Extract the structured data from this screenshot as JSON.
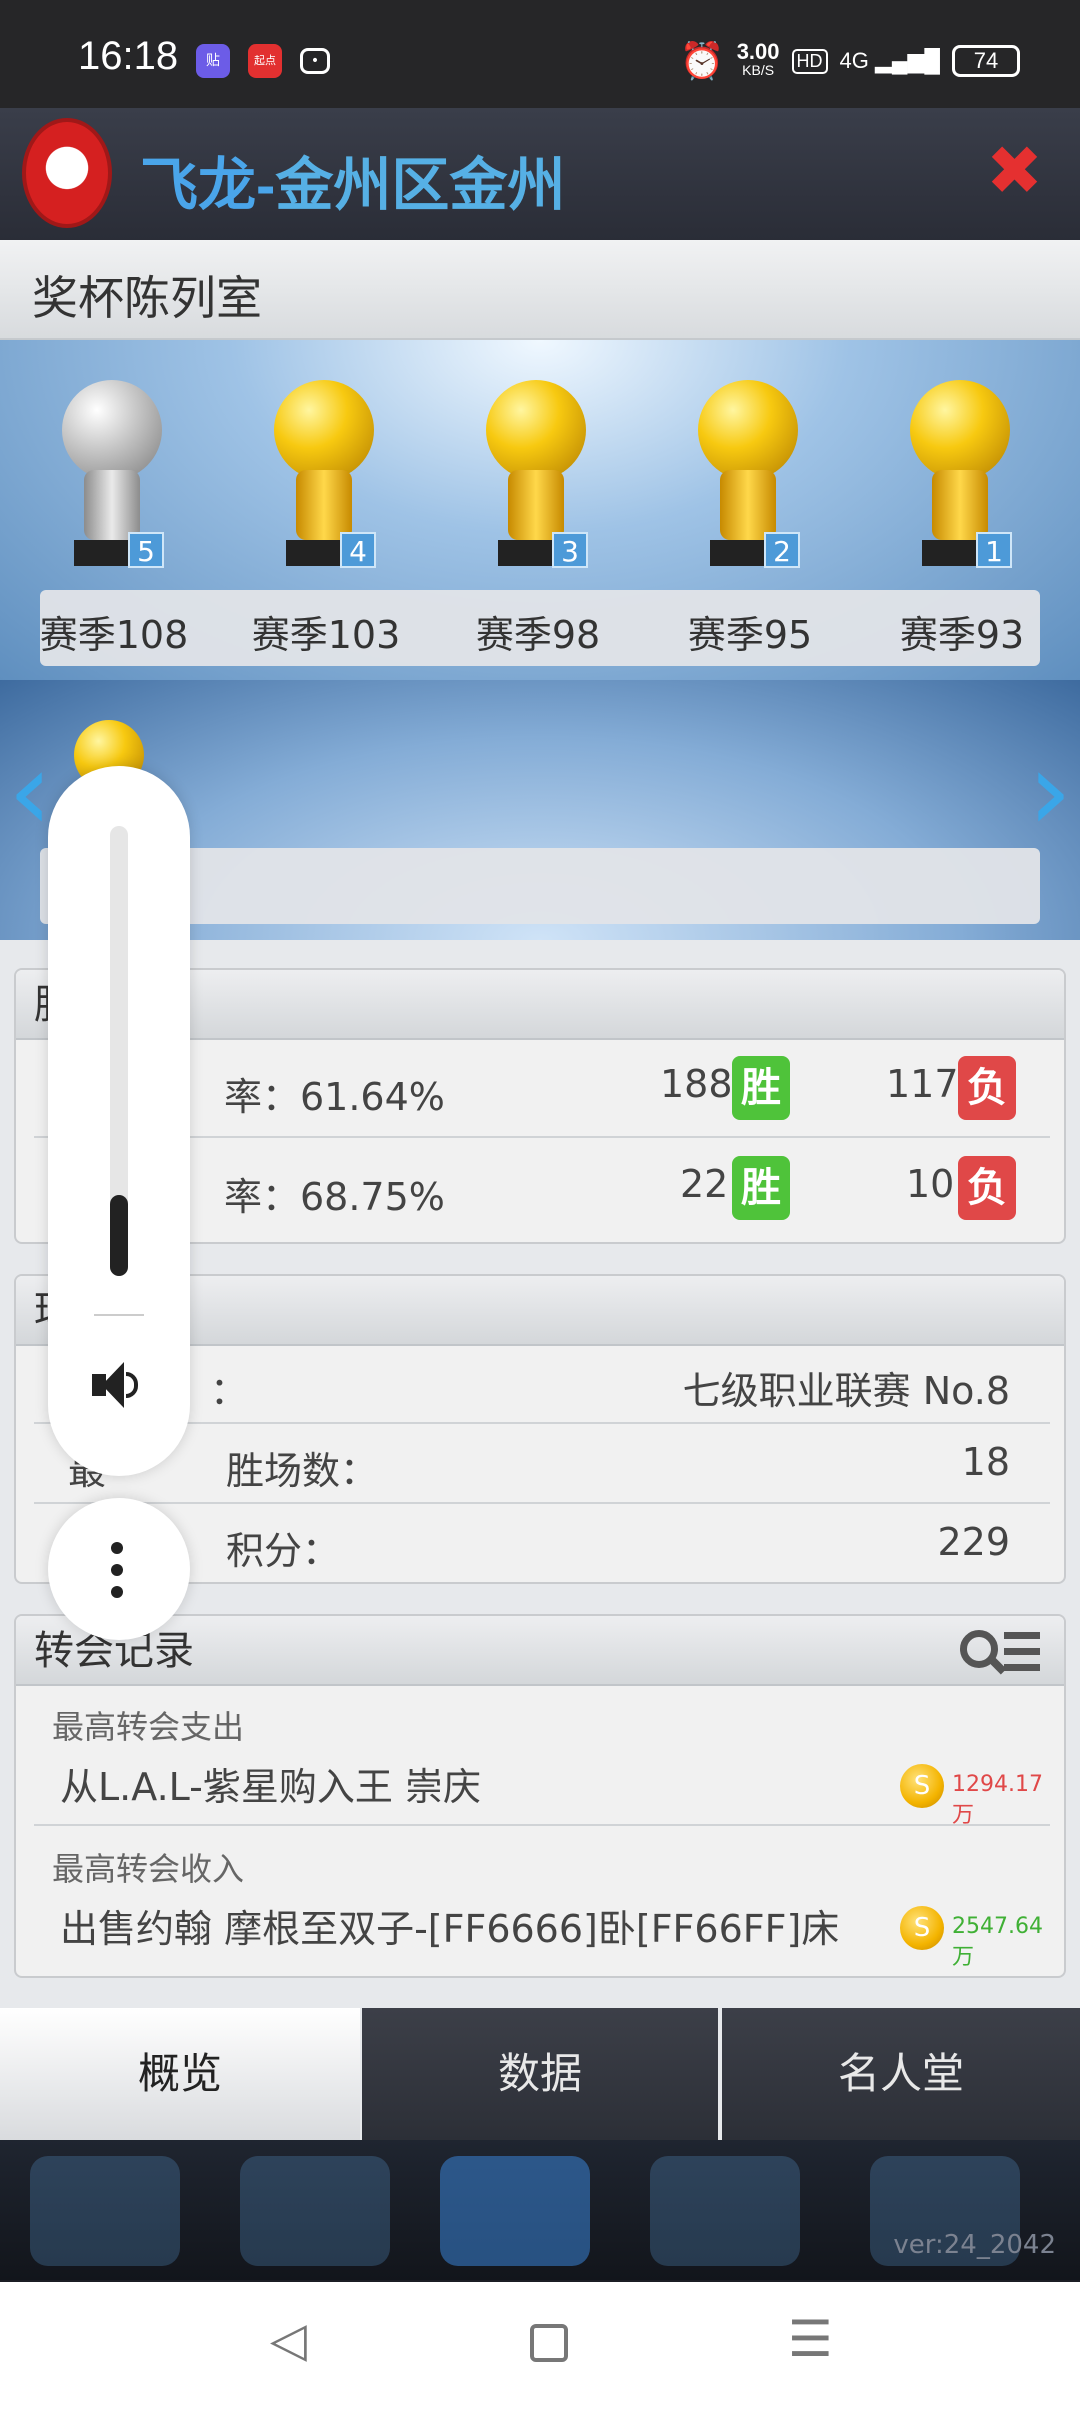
{
  "status": {
    "time": "16:18",
    "app1": "贴",
    "app2": "起点",
    "speed_value": "3.00",
    "speed_unit": "KB/S",
    "hd": "HD",
    "net": "4G",
    "battery": "74"
  },
  "header": {
    "title_prefix": "飞龙-",
    "title_rest": "金州区金州"
  },
  "trophy_room": {
    "title": "奖杯陈列室",
    "trophies": [
      {
        "label": "赛季108",
        "num": "5",
        "type": "silver"
      },
      {
        "label": "赛季103",
        "num": "4",
        "type": "gold"
      },
      {
        "label": "赛季98",
        "num": "3",
        "type": "gold"
      },
      {
        "label": "赛季95",
        "num": "2",
        "type": "gold"
      },
      {
        "label": "赛季93",
        "num": "1",
        "type": "gold"
      }
    ]
  },
  "record": {
    "header": "胜",
    "row1": {
      "rate": "率：61.64%",
      "wins": "188",
      "win_label": "胜",
      "losses": "117",
      "loss_label": "负"
    },
    "row2": {
      "rate": "率：68.75%",
      "wins": "22",
      "win_label": "胜",
      "losses": "10",
      "loss_label": "负"
    }
  },
  "honor": {
    "header": "球",
    "row1_label": "：",
    "row1_value": "七级职业联赛 No.8",
    "row2_label": "最",
    "row2_label2": "胜场数：",
    "row2_value": "18",
    "row3_label": "最",
    "row3_label2": "积分：",
    "row3_value": "229"
  },
  "transfer": {
    "title": "转会记录",
    "spend_label": "最高转会支出",
    "spend_text": "从L.A.L-紫星购入王 崇庆",
    "spend_amount": "1294.17万",
    "income_label": "最高转会收入",
    "income_text": "出售约翰 摩根至双子-[FF6666]卧[FF66FF]床",
    "income_amount": "2547.64万",
    "coin_symbol": "S"
  },
  "tabs": [
    "概览",
    "数据",
    "名人堂"
  ],
  "version": "ver:24_2042",
  "volume": {
    "level_fraction": 0.18
  },
  "colors": {
    "win": "#4fc33a",
    "lose": "#e04848",
    "spend": "#e04848",
    "income": "#3fb035",
    "accent": "#4aa5ea"
  }
}
